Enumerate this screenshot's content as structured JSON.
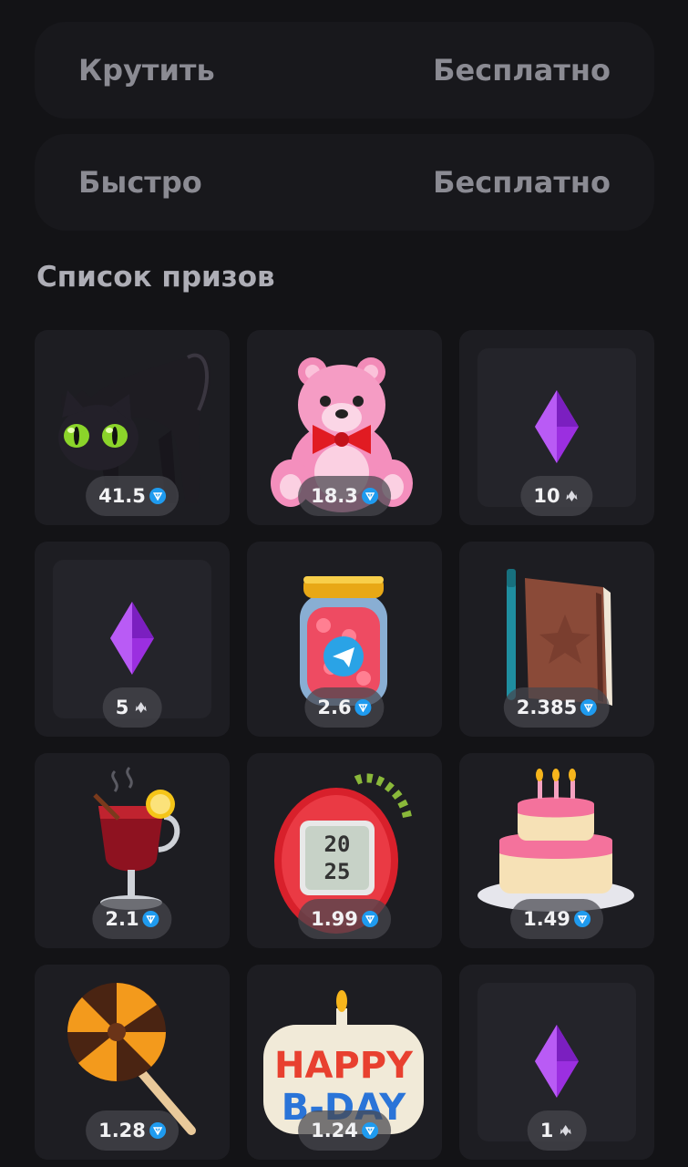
{
  "spin_buttons": [
    {
      "label": "Крутить",
      "price": "Бесплатно"
    },
    {
      "label": "Быстро",
      "price": "Бесплатно"
    }
  ],
  "prizes_title": "Список призов",
  "prizes": [
    {
      "item": "black cat",
      "value": "41.5",
      "currency": "ton-icon"
    },
    {
      "item": "pink teddy bear",
      "value": "18.3",
      "currency": "ton-icon"
    },
    {
      "item": "purple crystal",
      "value": "10",
      "currency": "crystal-icon"
    },
    {
      "item": "purple crystal",
      "value": "5",
      "currency": "crystal-icon"
    },
    {
      "item": "jar of hearts",
      "value": "2.6",
      "currency": "ton-icon"
    },
    {
      "item": "notebook with pen",
      "value": "2.385",
      "currency": "ton-icon"
    },
    {
      "item": "mulled wine",
      "value": "2.1",
      "currency": "ton-icon"
    },
    {
      "item": "tamagotchi 2025",
      "value": "1.99",
      "currency": "ton-icon"
    },
    {
      "item": "birthday cake",
      "value": "1.49",
      "currency": "ton-icon"
    },
    {
      "item": "lollipop",
      "value": "1.28",
      "currency": "ton-icon"
    },
    {
      "item": "happy b-day candle",
      "value": "1.24",
      "currency": "ton-icon"
    },
    {
      "item": "purple crystal",
      "value": "1",
      "currency": "crystal-icon"
    }
  ],
  "colors": {
    "background": "#131316",
    "card": "#1d1d22",
    "ton_blue": "#1f9bef",
    "crystal_purple": "#9b2fe0"
  }
}
